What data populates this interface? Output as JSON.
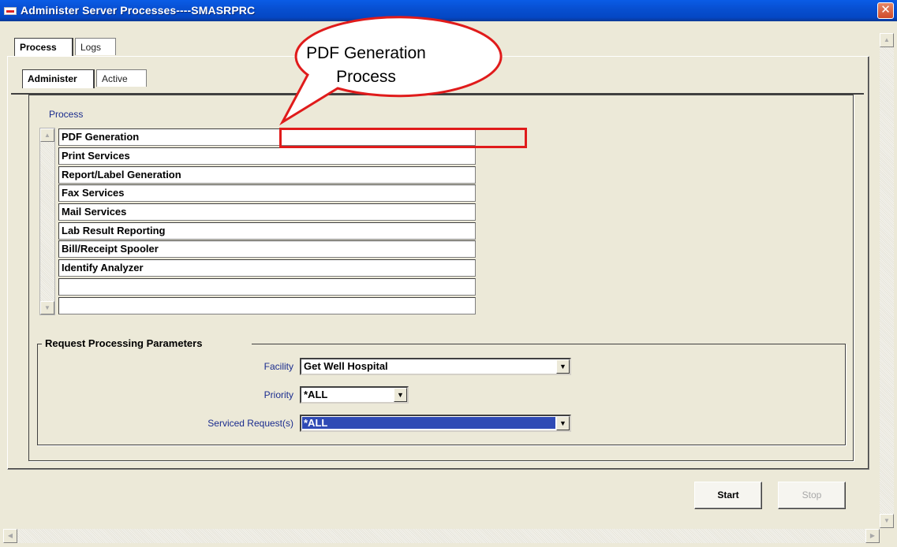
{
  "window": {
    "title": "Administer Server Processes----SMASRPRC",
    "close_glyph": "✕"
  },
  "tabs_top": [
    {
      "label": "Process",
      "active": true
    },
    {
      "label": "Logs",
      "active": false
    }
  ],
  "tabs_sub": [
    {
      "label": "Administer",
      "active": true
    },
    {
      "label": "Active",
      "active": false
    }
  ],
  "process_list": {
    "label": "Process",
    "items": [
      "PDF Generation",
      "Print Services",
      "Report/Label Generation",
      "Fax Services",
      "Mail Services",
      "Lab Result Reporting",
      "Bill/Receipt Spooler",
      "Identify Analyzer",
      "",
      ""
    ]
  },
  "parameters": {
    "group_title": "Request Processing Parameters",
    "facility": {
      "label": "Facility",
      "value": "Get Well Hospital"
    },
    "priority": {
      "label": "Priority",
      "value": "*ALL"
    },
    "serviced": {
      "label": "Serviced Request(s)",
      "value": "*ALL"
    }
  },
  "buttons": {
    "start": "Start",
    "stop": "Stop"
  },
  "callout": {
    "text_line1": "PDF Generation",
    "text_line2": "Process",
    "color": "#e01b1b"
  },
  "icons": {
    "scroll_up": "▲",
    "scroll_down": "▼",
    "scroll_left": "◀",
    "scroll_right": "▶",
    "dropdown": "▼"
  }
}
